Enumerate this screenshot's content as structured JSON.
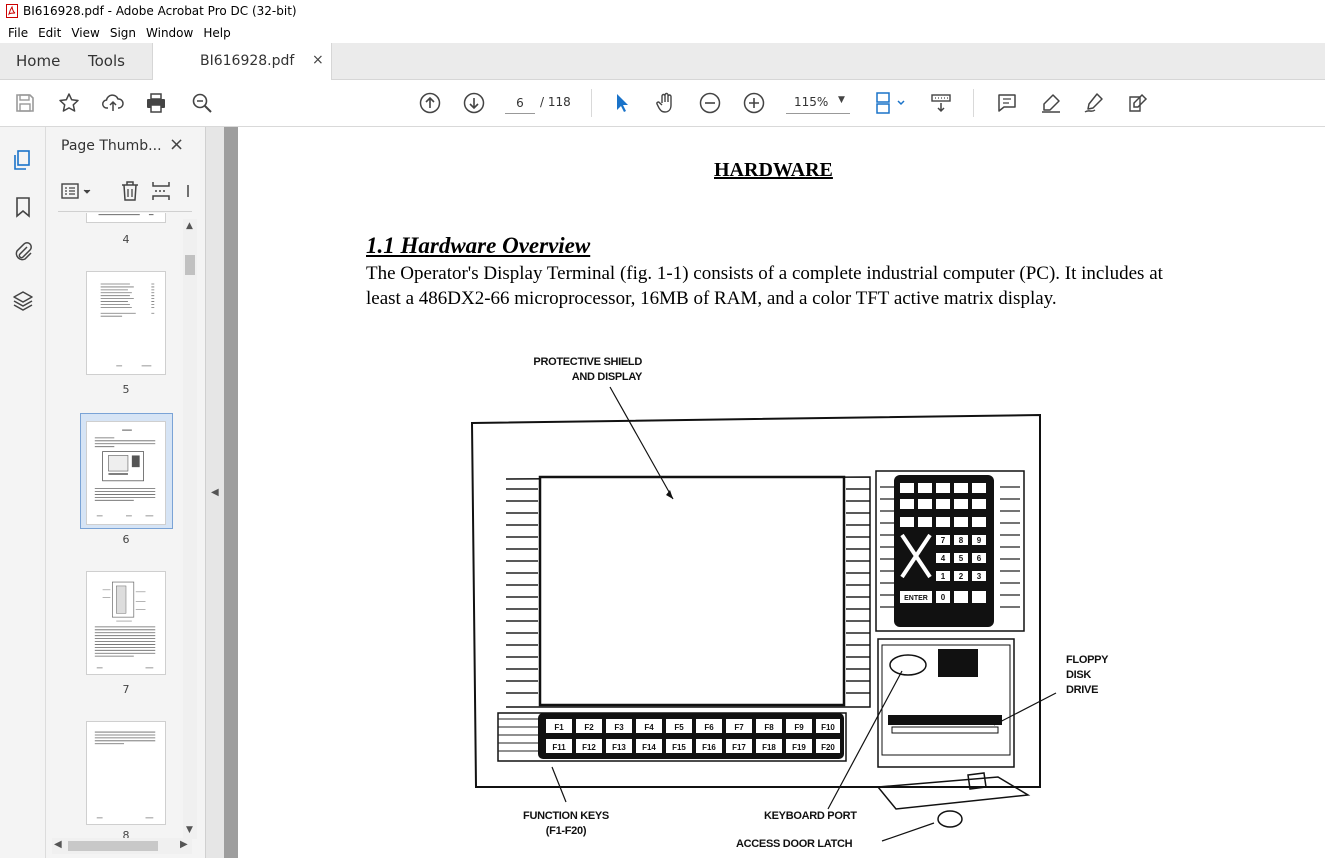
{
  "window": {
    "title": "BI616928.pdf - Adobe Acrobat Pro DC (32-bit)"
  },
  "menubar": {
    "items": [
      "File",
      "Edit",
      "View",
      "Sign",
      "Window",
      "Help"
    ]
  },
  "tabs": {
    "home": "Home",
    "tools": "Tools",
    "document": "BI616928.pdf",
    "close_glyph": "×"
  },
  "toolbar": {
    "current_page": "6",
    "page_total": "/ 118",
    "zoom": "115%",
    "icons": [
      "save-icon",
      "star-icon",
      "upload-icon",
      "print-icon",
      "zoom-search-icon",
      "prev-page-icon",
      "next-page-icon",
      "select-cursor-icon",
      "hand-icon",
      "zoom-out-icon",
      "zoom-in-icon",
      "page-fit-icon",
      "scroll-mode-icon",
      "comment-icon",
      "highlight-icon",
      "draw-icon",
      "fill-sign-icon"
    ]
  },
  "sidebar": {
    "panel_title": "Page Thumb...",
    "thumbnails": [
      {
        "label": "4"
      },
      {
        "label": "5"
      },
      {
        "label": "6",
        "selected": true
      },
      {
        "label": "7"
      },
      {
        "label": "8"
      }
    ]
  },
  "document": {
    "heading": "HARDWARE",
    "section_title": "1.1  Hardware Overview",
    "body": "The Operator's Display Terminal (fig. 1-1) consists of a complete industrial computer (PC).  It includes at least a 486DX2-66 microprocessor, 16MB of RAM, and a color TFT active matrix display.",
    "figure": {
      "callouts": {
        "shield": "PROTECTIVE SHIELD\nAND DISPLAY",
        "floppy": "FLOPPY\nDISK\nDRIVE",
        "function_keys": "FUNCTION KEYS\n(F1-F20)",
        "keyboard_port": "KEYBOARD PORT",
        "access_latch": "ACCESS DOOR LATCH"
      },
      "fkeys_row1": [
        "F1",
        "F2",
        "F3",
        "F4",
        "F5",
        "F6",
        "F7",
        "F8",
        "F9",
        "F10"
      ],
      "fkeys_row2": [
        "F11",
        "F12",
        "F13",
        "F14",
        "F15",
        "F16",
        "F17",
        "F18",
        "F19",
        "F20"
      ],
      "keypad_enter": "ENTER",
      "keypad_digits": [
        "7",
        "8",
        "9",
        "4",
        "5",
        "6",
        "1",
        "2",
        "3",
        "0"
      ]
    }
  }
}
